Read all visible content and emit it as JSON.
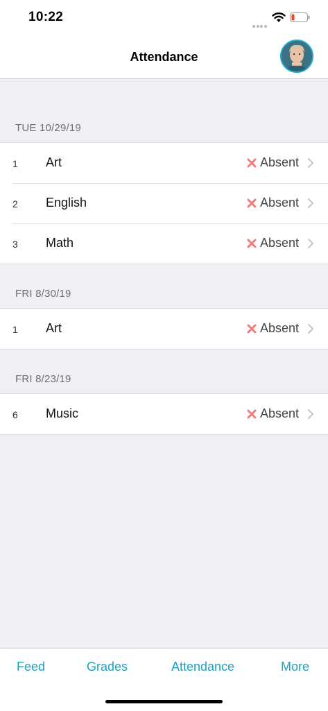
{
  "status_bar": {
    "time": "10:22",
    "battery_color": "#ff3b30"
  },
  "nav": {
    "title": "Attendance"
  },
  "sections": [
    {
      "date": "TUE 10/29/19",
      "rows": [
        {
          "period": "1",
          "subject": "Art",
          "status": "Absent"
        },
        {
          "period": "2",
          "subject": "English",
          "status": "Absent"
        },
        {
          "period": "3",
          "subject": "Math",
          "status": "Absent"
        }
      ]
    },
    {
      "date": "FRI 8/30/19",
      "rows": [
        {
          "period": "1",
          "subject": "Art",
          "status": "Absent"
        }
      ]
    },
    {
      "date": "FRI 8/23/19",
      "rows": [
        {
          "period": "6",
          "subject": "Music",
          "status": "Absent"
        }
      ]
    }
  ],
  "tabs": [
    {
      "label": "Feed"
    },
    {
      "label": "Grades"
    },
    {
      "label": "Attendance"
    },
    {
      "label": "More"
    }
  ],
  "colors": {
    "accent": "#1aa3c4",
    "absent": "#f07b7b"
  }
}
